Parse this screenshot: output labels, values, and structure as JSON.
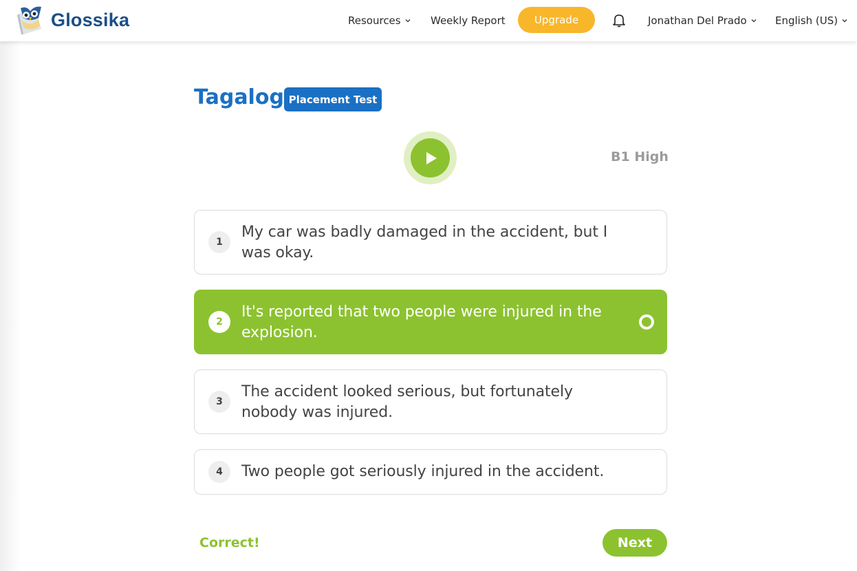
{
  "header": {
    "brand": "Glossika",
    "nav": {
      "resources": "Resources",
      "weekly_report": "Weekly Report",
      "upgrade": "Upgrade",
      "user": "Jonathan Del Prado",
      "language": "English (US)"
    }
  },
  "main": {
    "language_title": "Tagalog",
    "badge": "Placement Test",
    "level": "B1 High",
    "options": [
      {
        "number": "1",
        "text": "My car was badly damaged in the accident, but I was okay.",
        "selected": false
      },
      {
        "number": "2",
        "text": "It's reported that two people were injured in the explosion.",
        "selected": true
      },
      {
        "number": "3",
        "text": "The accident looked serious, but fortunately nobody was injured.",
        "selected": false
      },
      {
        "number": "4",
        "text": "Two people got seriously injured in the accident.",
        "selected": false
      }
    ],
    "feedback": "Correct!",
    "next_label": "Next"
  },
  "colors": {
    "brand_blue": "#1a70c4",
    "logo_blue": "#1b4f86",
    "accent_green": "#8cc22f",
    "upgrade_yellow": "#f8b62a"
  },
  "icons": [
    "owl-logo-icon",
    "chevron-down-icon",
    "bell-icon",
    "play-icon",
    "radio-circle-icon"
  ]
}
